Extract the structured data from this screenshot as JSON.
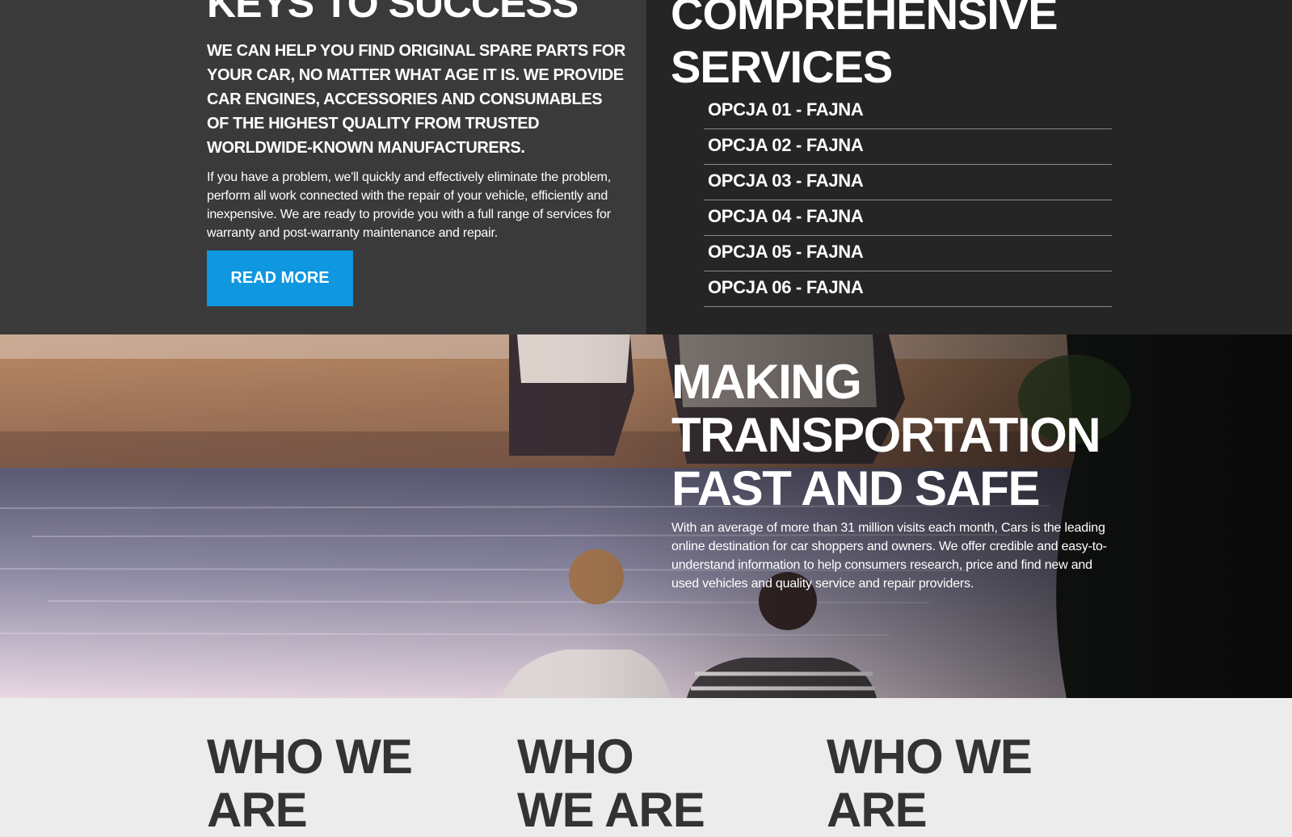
{
  "keys": {
    "heading": "KEYS TO SUCCESS",
    "lead": "WE CAN HELP YOU FIND ORIGINAL SPARE PARTS FOR YOUR CAR, NO MATTER WHAT AGE IT IS. WE PROVIDE CAR ENGINES, ACCESSORIES AND CONSUMABLES OF THE HIGHEST QUALITY FROM TRUSTED WORLDWIDE-KNOWN MANUFACTURERS.",
    "body": "If you have a problem, we'll quickly and effectively eliminate the problem, perform all work connected with the repair of your vehicle, efficiently and inexpensive. We are ready to provide you with a full range of services for warranty and post-warranty maintenance and repair.",
    "button_label": "READ MORE"
  },
  "services": {
    "heading": "COMPREHENSIVE SERVICES",
    "items": [
      "OPCJA 01 - FAJNA",
      "OPCJA 02 - FAJNA",
      "OPCJA 03 - FAJNA",
      "OPCJA 04 - FAJNA",
      "OPCJA 05 - FAJNA",
      "OPCJA 06 - FAJNA"
    ]
  },
  "hero": {
    "heading": "MAKING TRANSPORTATION FAST AND SAFE",
    "text": "With an average of more than 31 million visits each month, Cars is the leading online destination for car shoppers and owners. We offer credible and easy-to-understand information to help consumers research, price and find new and used vehicles and quality service and repair providers."
  },
  "who": {
    "col1": "WHO WE ARE",
    "col2": "WHO WE ARE",
    "col3": "WHO WE ARE"
  },
  "colors": {
    "accent": "#0f97e0",
    "dark_left": "#3a3a3a",
    "dark_right": "#252525",
    "light_bg": "#ececec"
  }
}
